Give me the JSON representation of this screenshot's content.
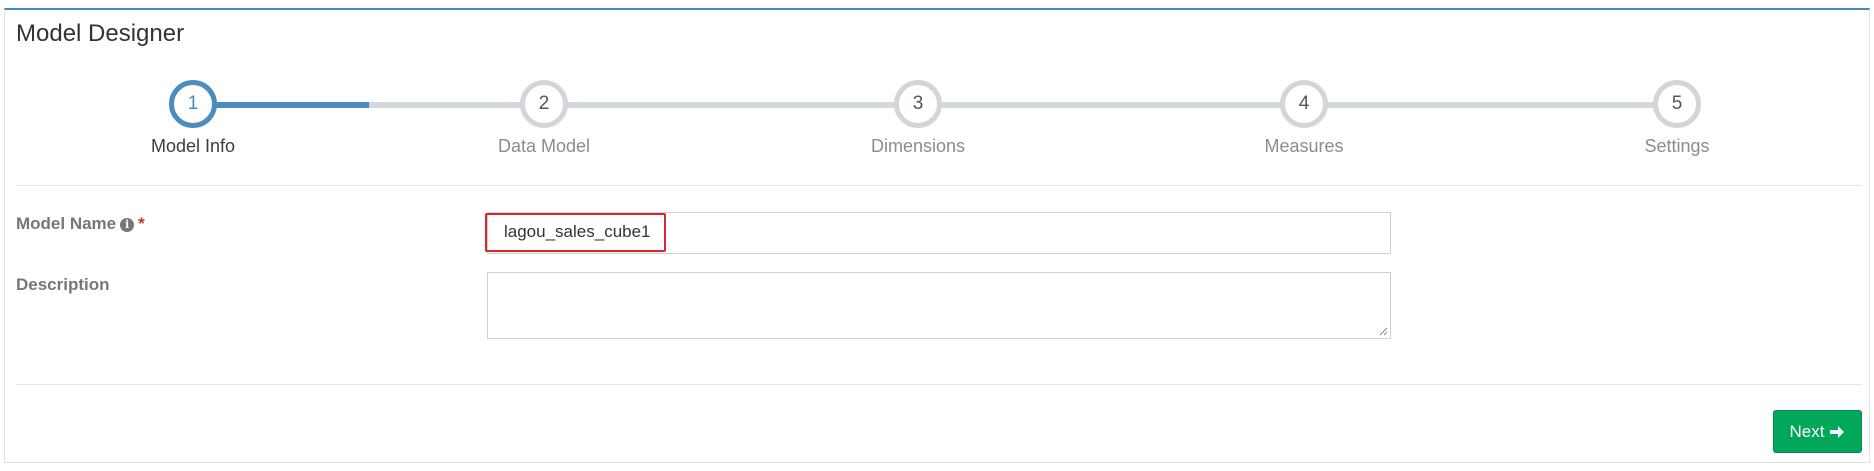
{
  "page": {
    "title": "Model Designer"
  },
  "wizard": {
    "progress_fraction": 0.5,
    "steps": [
      {
        "number": "1",
        "label": "Model Info",
        "active": true
      },
      {
        "number": "2",
        "label": "Data Model",
        "active": false
      },
      {
        "number": "3",
        "label": "Dimensions",
        "active": false
      },
      {
        "number": "4",
        "label": "Measures",
        "active": false
      },
      {
        "number": "5",
        "label": "Settings",
        "active": false
      }
    ]
  },
  "form": {
    "model_name": {
      "label": "Model Name",
      "required_mark": "*",
      "value": "lagou_sales_cube1"
    },
    "description": {
      "label": "Description",
      "value": ""
    }
  },
  "actions": {
    "next_label": "Next"
  },
  "colors": {
    "accent": "#4b8dbf",
    "success": "#00a65a",
    "highlight": "#d9262b",
    "required": "#c0392b"
  },
  "icons": {
    "info": "info-circle-icon",
    "next": "arrow-right-icon"
  }
}
